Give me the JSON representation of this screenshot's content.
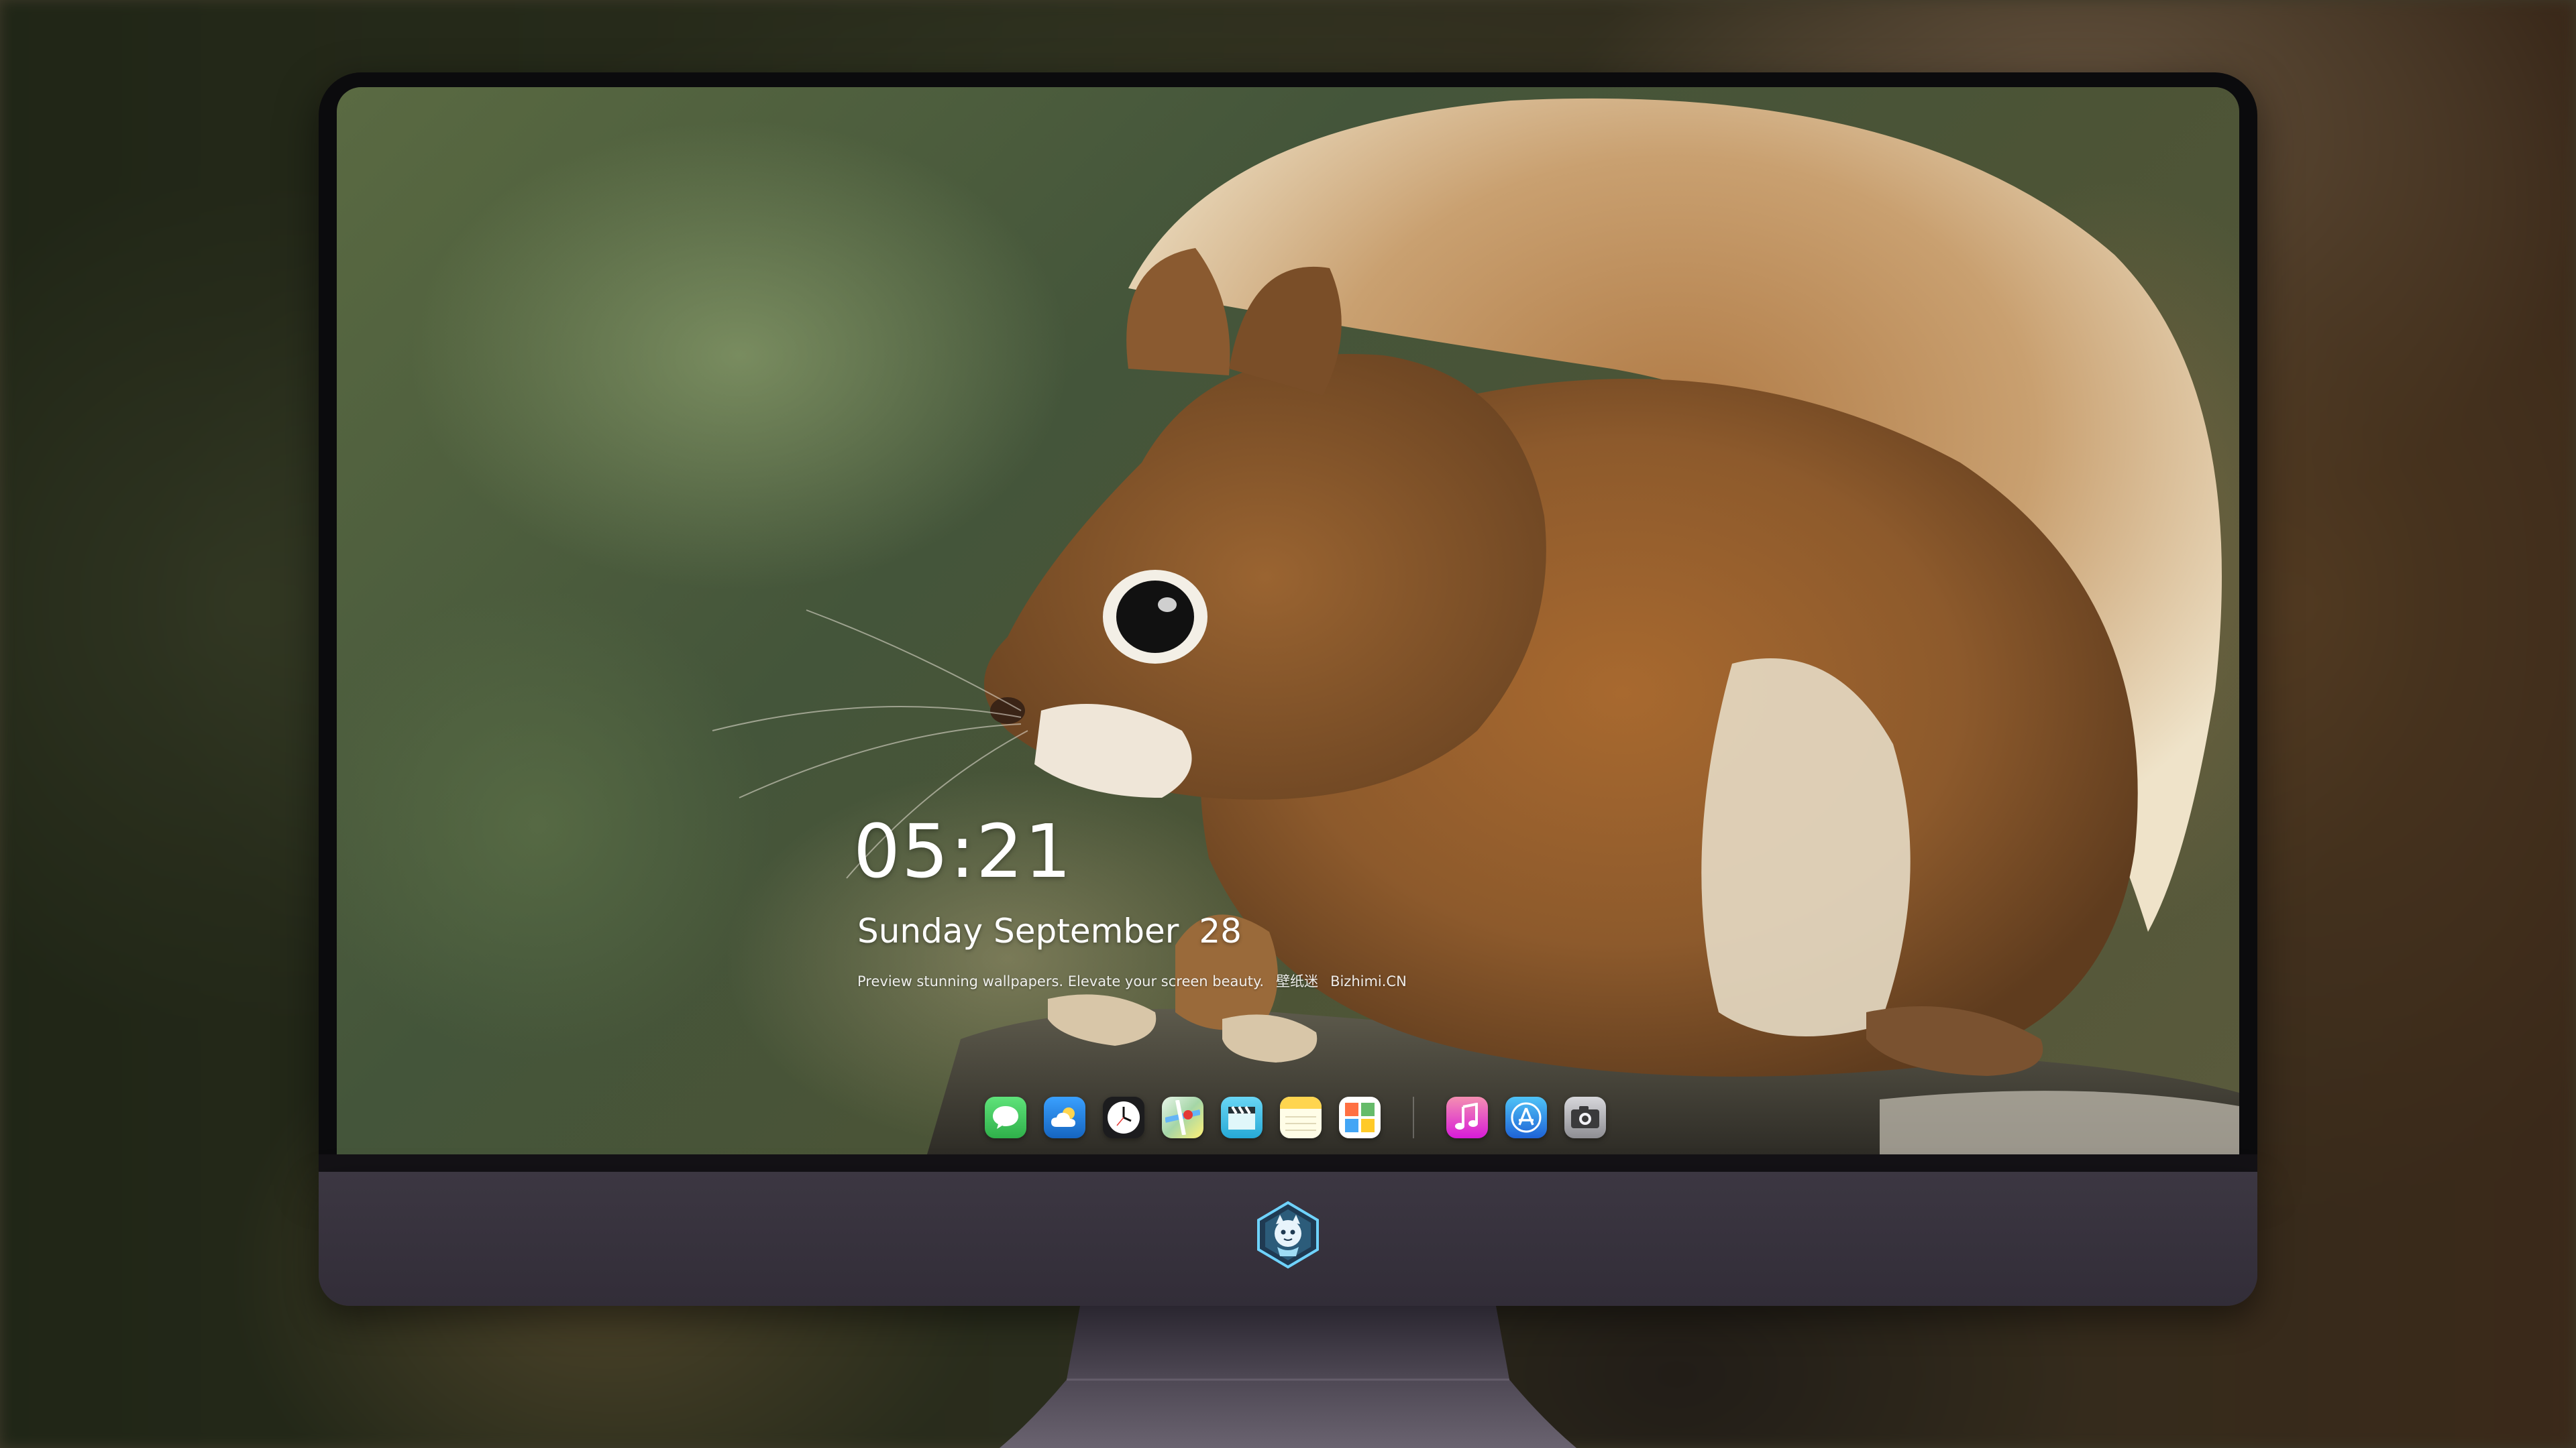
{
  "lockscreen": {
    "time": "05:21",
    "date_weekday_month": "Sunday September",
    "date_day": "28",
    "tagline": "Preview stunning wallpapers. Elevate your screen beauty.",
    "brand_cn": "壁纸迷",
    "site": "Bizhimi.CN"
  },
  "dock": {
    "items": [
      {
        "name": "messages",
        "icon": "messages-icon",
        "color": "#34c759"
      },
      {
        "name": "weather",
        "icon": "weather-icon",
        "color": "#1e88e5"
      },
      {
        "name": "clock",
        "icon": "clock-icon",
        "color": "#ffffff"
      },
      {
        "name": "maps",
        "icon": "maps-icon",
        "color": "#4caf50"
      },
      {
        "name": "video",
        "icon": "clapperboard-icon",
        "color": "#3ec4e8"
      },
      {
        "name": "notes",
        "icon": "notes-icon",
        "color": "#ffd54f"
      },
      {
        "name": "photos",
        "icon": "photos-icon",
        "color": "#ffffff"
      },
      {
        "name": "music",
        "icon": "music-note-icon",
        "color": "#e040fb"
      },
      {
        "name": "app-store",
        "icon": "app-store-icon",
        "color": "#1e88e5"
      },
      {
        "name": "camera",
        "icon": "camera-icon",
        "color": "#8e8e93"
      }
    ]
  },
  "colors": {
    "bezel": "#0b0b0d",
    "chin": "#3c3742",
    "text": "#ffffff"
  }
}
